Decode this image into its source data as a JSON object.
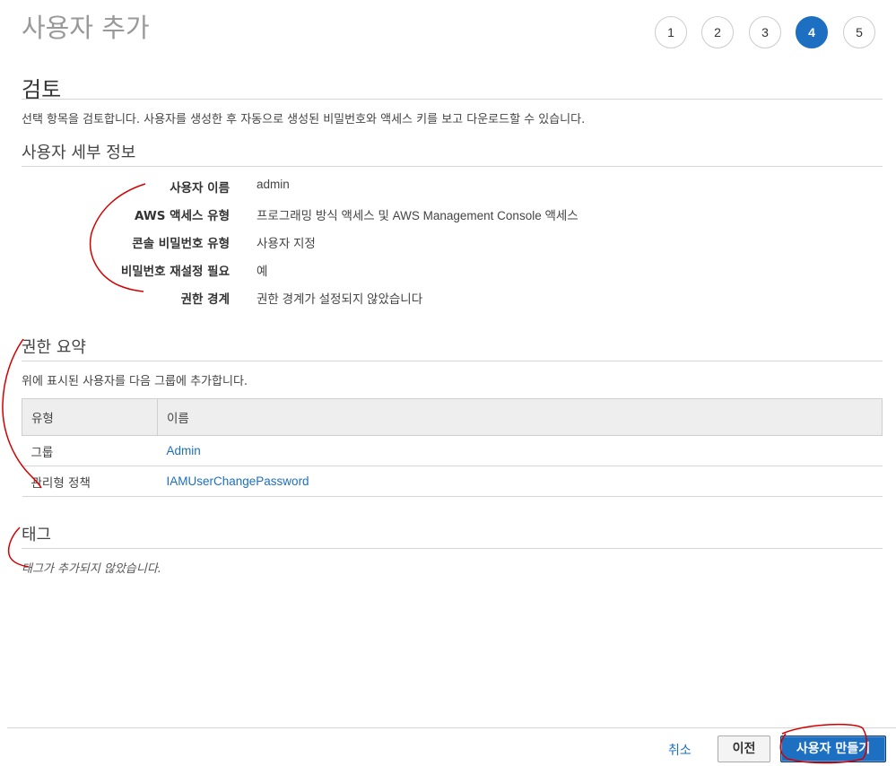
{
  "header": {
    "title": "사용자 추가",
    "steps": [
      "1",
      "2",
      "3",
      "4",
      "5"
    ],
    "active_step": "4"
  },
  "review": {
    "heading": "검토",
    "description": "선택 항목을 검토합니다. 사용자를 생성한 후 자동으로 생성된 비밀번호와 액세스 키를 보고 다운로드할 수 있습니다."
  },
  "user_details": {
    "heading": "사용자 세부 정보",
    "rows": [
      {
        "label": "사용자 이름",
        "value": "admin"
      },
      {
        "label": "AWS 액세스 유형",
        "value": "프로그래밍 방식 액세스 및 AWS Management Console 액세스"
      },
      {
        "label": "콘솔 비밀번호 유형",
        "value": "사용자 지정"
      },
      {
        "label": "비밀번호 재설정 필요",
        "value": "예"
      },
      {
        "label": "권한 경계",
        "value": "권한 경계가 설정되지 않았습니다"
      }
    ]
  },
  "permissions": {
    "heading": "권한 요약",
    "description": "위에 표시된 사용자를 다음 그룹에 추가합니다.",
    "columns": [
      "유형",
      "이름"
    ],
    "rows": [
      {
        "type": "그룹",
        "name": "Admin"
      },
      {
        "type": "관리형 정책",
        "name": "IAMUserChangePassword"
      }
    ]
  },
  "tags": {
    "heading": "태그",
    "empty_message": "태그가 추가되지 않았습니다."
  },
  "footer": {
    "cancel_label": "취소",
    "previous_label": "이전",
    "create_label": "사용자 만들기"
  },
  "colors": {
    "accent": "#1d6fc1",
    "annotation": "#d40000"
  }
}
